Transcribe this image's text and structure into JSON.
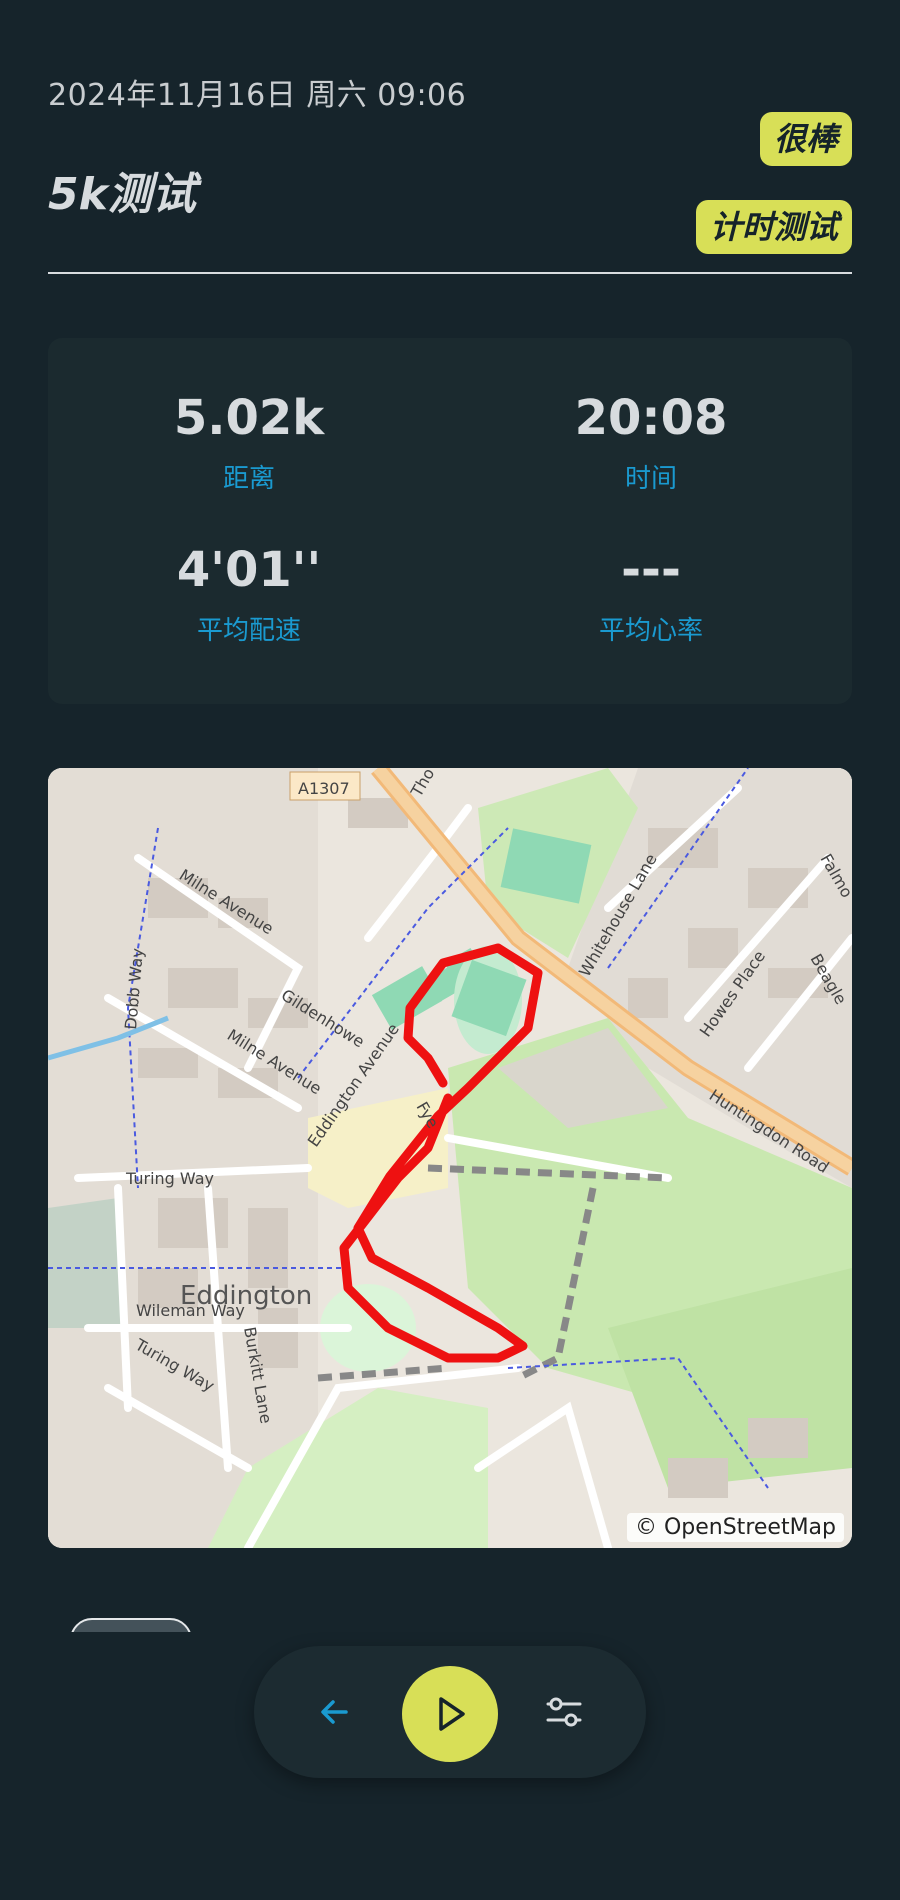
{
  "header": {
    "datetime": "2024年11月16日 周六 09:06",
    "title": "5k测试",
    "tags": [
      "很棒",
      "计时测试"
    ]
  },
  "stats": [
    {
      "value": "5.02k",
      "label": "距离"
    },
    {
      "value": "20:08",
      "label": "时间"
    },
    {
      "value": "4'01''",
      "label": "平均配速"
    },
    {
      "value": "---",
      "label": "平均心率"
    }
  ],
  "map": {
    "attribution": "© OpenStreetMap",
    "labels": {
      "road_a1307": "A1307",
      "huntingdon": "Huntingdon Road",
      "whitehouse": "Whitehouse Lane",
      "milne1": "Milne Avenue",
      "milne2": "Milne Avenue",
      "gildenhowe": "Gildenhowe",
      "eddington_ave": "Eddington Avenue",
      "dobb": "Dobb Way",
      "turing1": "Turing Way",
      "turing2": "Turing Way",
      "wileman": "Wileman Way",
      "burkitt": "Burkitt Lane",
      "howes": "Howes Place",
      "beagle": "Beagle",
      "falmouth": "Falmo",
      "eddington": "Eddington",
      "tho": "Tho",
      "fye": "Fye"
    },
    "colors": {
      "route": "#ee1111",
      "road_primary": "#f4c98e",
      "park": "#c8eab0",
      "pitch": "#8fd9b4"
    }
  },
  "nav": {
    "back_icon": "arrow-left-icon",
    "play_icon": "play-icon",
    "filter_icon": "sliders-icon",
    "accent": "#d8df57"
  }
}
